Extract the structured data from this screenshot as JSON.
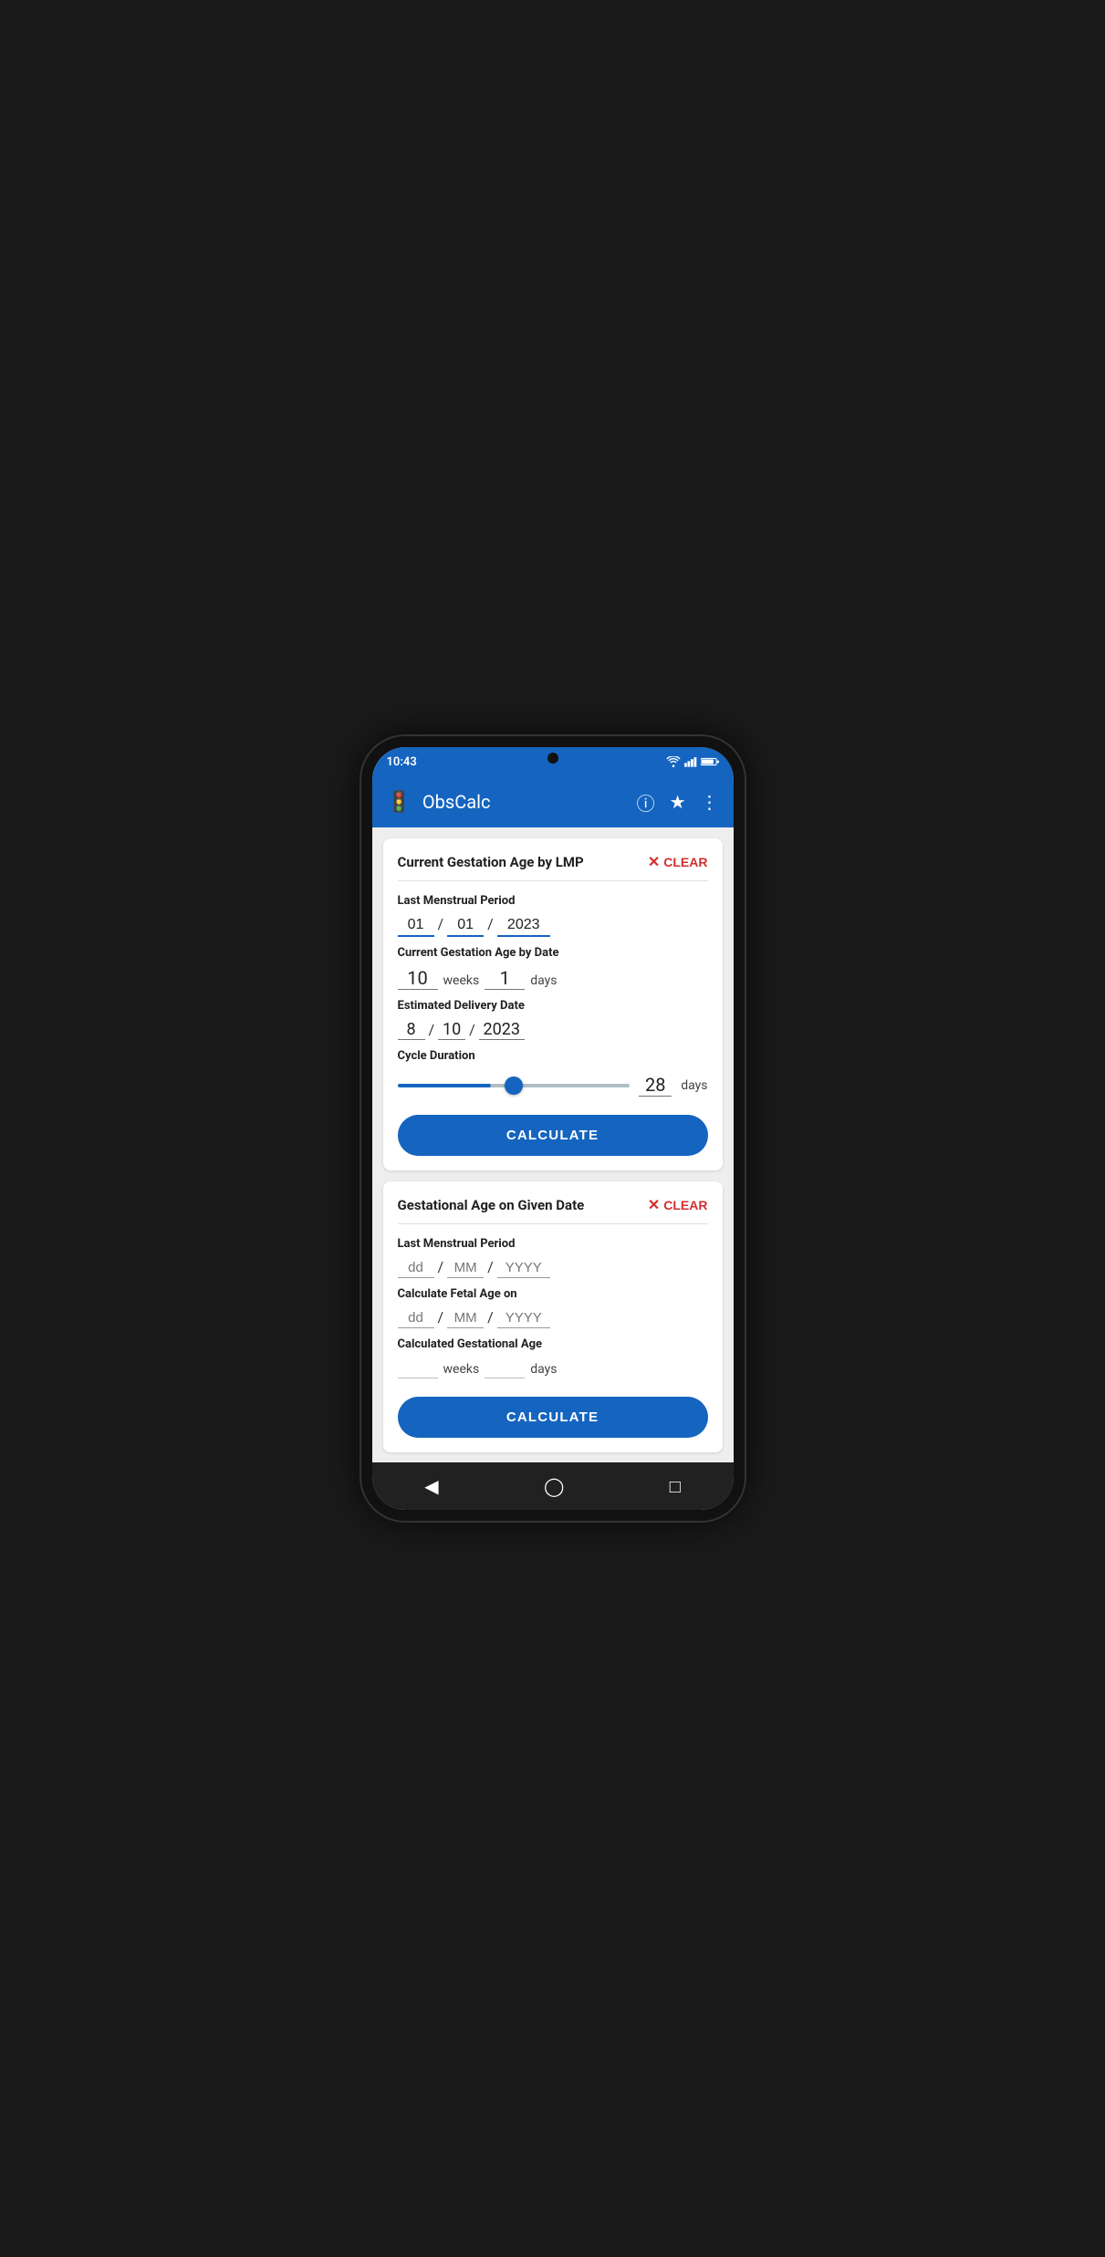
{
  "statusBar": {
    "time": "10:43",
    "icons": [
      "wifi",
      "signal",
      "battery"
    ]
  },
  "appBar": {
    "title": "ObsCalc",
    "icon": "stroller",
    "actions": [
      "help",
      "star",
      "more"
    ]
  },
  "card1": {
    "title": "Current Gestation Age by LMP",
    "clearLabel": "CLEAR",
    "lmpLabel": "Last Menstrual Period",
    "lmpDay": "01",
    "lmpMonth": "01",
    "lmpYear": "2023",
    "gestationLabel": "Current Gestation Age by Date",
    "gestationWeeks": "10",
    "gestationDays": "1",
    "weeksUnit": "weeks",
    "daysUnit": "days",
    "eddLabel": "Estimated Delivery Date",
    "eddDay": "8",
    "eddMonth": "10",
    "eddYear": "2023",
    "cycleDurationLabel": "Cycle Duration",
    "cycleDays": "28",
    "cycleUnit": "days",
    "sliderMin": 21,
    "sliderMax": 35,
    "sliderValue": 28,
    "calculateLabel": "CALCULATE"
  },
  "card2": {
    "title": "Gestational Age on Given Date",
    "clearLabel": "CLEAR",
    "lmpLabel": "Last Menstrual Period",
    "lmpDayPlaceholder": "dd",
    "lmpMonthPlaceholder": "MM",
    "lmpYearPlaceholder": "YYYY",
    "fetalAgeLabel": "Calculate Fetal Age on",
    "fetalDayPlaceholder": "dd",
    "fetalMonthPlaceholder": "MM",
    "fetalYearPlaceholder": "YYYY",
    "resultLabel": "Calculated Gestational Age",
    "resultWeeksPlaceholder": "",
    "resultDaysPlaceholder": "",
    "weeksUnit": "weeks",
    "daysUnit": "days",
    "calculateLabel": "CALCULATE"
  },
  "navBar": {
    "icons": [
      "back",
      "home",
      "square"
    ]
  }
}
